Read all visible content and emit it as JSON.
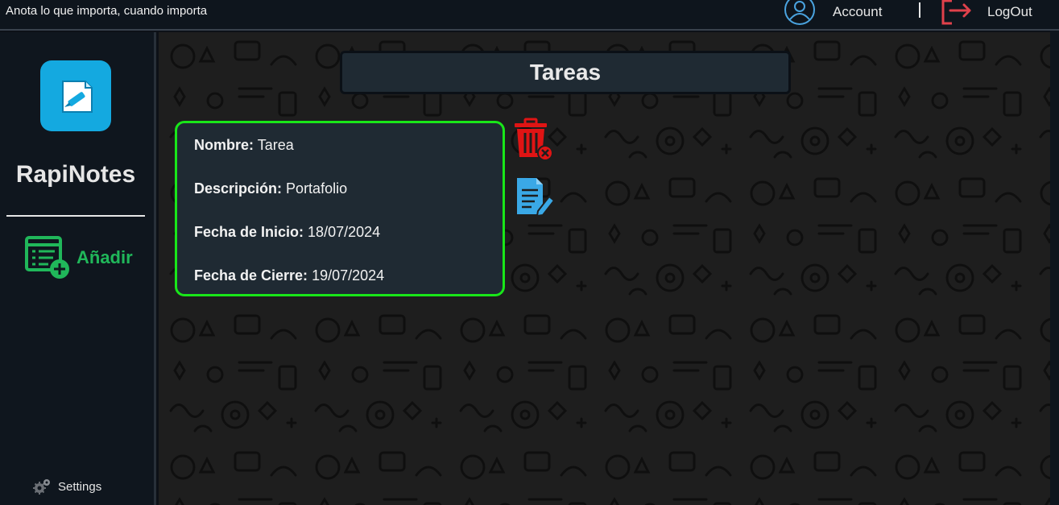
{
  "topbar": {
    "tagline": "Anota lo que importa, cuando importa",
    "account_label": "Account",
    "logout_label": "LogOut"
  },
  "sidebar": {
    "brand": "RapiNotes",
    "add_label": "Añadir",
    "settings_label": "Settings"
  },
  "main": {
    "title": "Tareas",
    "task": {
      "name_label": "Nombre:",
      "name_value": "Tarea",
      "desc_label": "Descripción:",
      "desc_value": "Portafolio",
      "start_label": "Fecha de Inicio:",
      "start_value": "18/07/2024",
      "end_label": "Fecha de Cierre:",
      "end_value": "19/07/2024"
    }
  },
  "colors": {
    "accent_green": "#20b75a",
    "card_border": "#19e619",
    "logo_blue": "#14a9e0",
    "delete_red": "#e01414",
    "edit_blue": "#3aa8e6",
    "logout_red": "#e0414b"
  },
  "icons": [
    "user-circle-icon",
    "logout-icon",
    "note-logo-icon",
    "add-list-icon",
    "gear-icon",
    "trash-icon",
    "edit-document-icon"
  ]
}
